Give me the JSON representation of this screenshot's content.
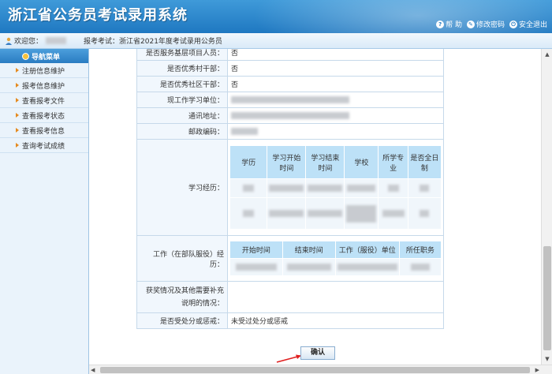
{
  "header": {
    "title": "浙江省公务员考试录用系统",
    "links": [
      {
        "icon": "help-icon",
        "glyph": "?",
        "label": "帮 助"
      },
      {
        "icon": "lock-icon",
        "glyph": "✎",
        "label": "修改密码"
      },
      {
        "icon": "logout-icon",
        "glyph": "⏻",
        "label": "安全退出"
      }
    ]
  },
  "userbar": {
    "welcome": "欢迎您：",
    "exam_label": "报考考试：浙江省2021年度考试录用公务员"
  },
  "sidebar": {
    "heading": "导航菜单",
    "items": [
      {
        "label": "注册信息维护"
      },
      {
        "label": "报考信息维护"
      },
      {
        "label": "查看报考文件"
      },
      {
        "label": "查看报考状态"
      },
      {
        "label": "查看报考信息"
      },
      {
        "label": "查询考试成绩"
      }
    ]
  },
  "form": {
    "rows": {
      "service_grassroots": {
        "label": "是否服务基层项目人员：",
        "value": "否"
      },
      "excellent_village": {
        "label": "是否优秀村干部：",
        "value": "否"
      },
      "excellent_community": {
        "label": "是否优秀社区干部：",
        "value": "否"
      },
      "current_unit": {
        "label": "现工作学习单位："
      },
      "address": {
        "label": "通讯地址："
      },
      "postcode": {
        "label": "邮政编码："
      },
      "study": {
        "label": "学习经历："
      },
      "work": {
        "label": "工作（在部队服役）经历："
      },
      "awards": {
        "label": "获奖情况及其他需要补充说明的情况："
      },
      "punishment": {
        "label": "是否受处分或惩戒：",
        "value": "未受过处分或惩戒"
      }
    },
    "study_headers": [
      "学历",
      "学习开始时间",
      "学习结束时间",
      "学校",
      "所学专业",
      "是否全日制"
    ],
    "work_headers": [
      "开始时间",
      "结束时间",
      "工作（服役）单位",
      "所任职务"
    ]
  },
  "confirm_label": "确认",
  "colors": {
    "banner": "#1f78c1",
    "nav_head": "#2a7cc2",
    "sub_header": "#bde1f7",
    "arrow": "#e02020"
  }
}
